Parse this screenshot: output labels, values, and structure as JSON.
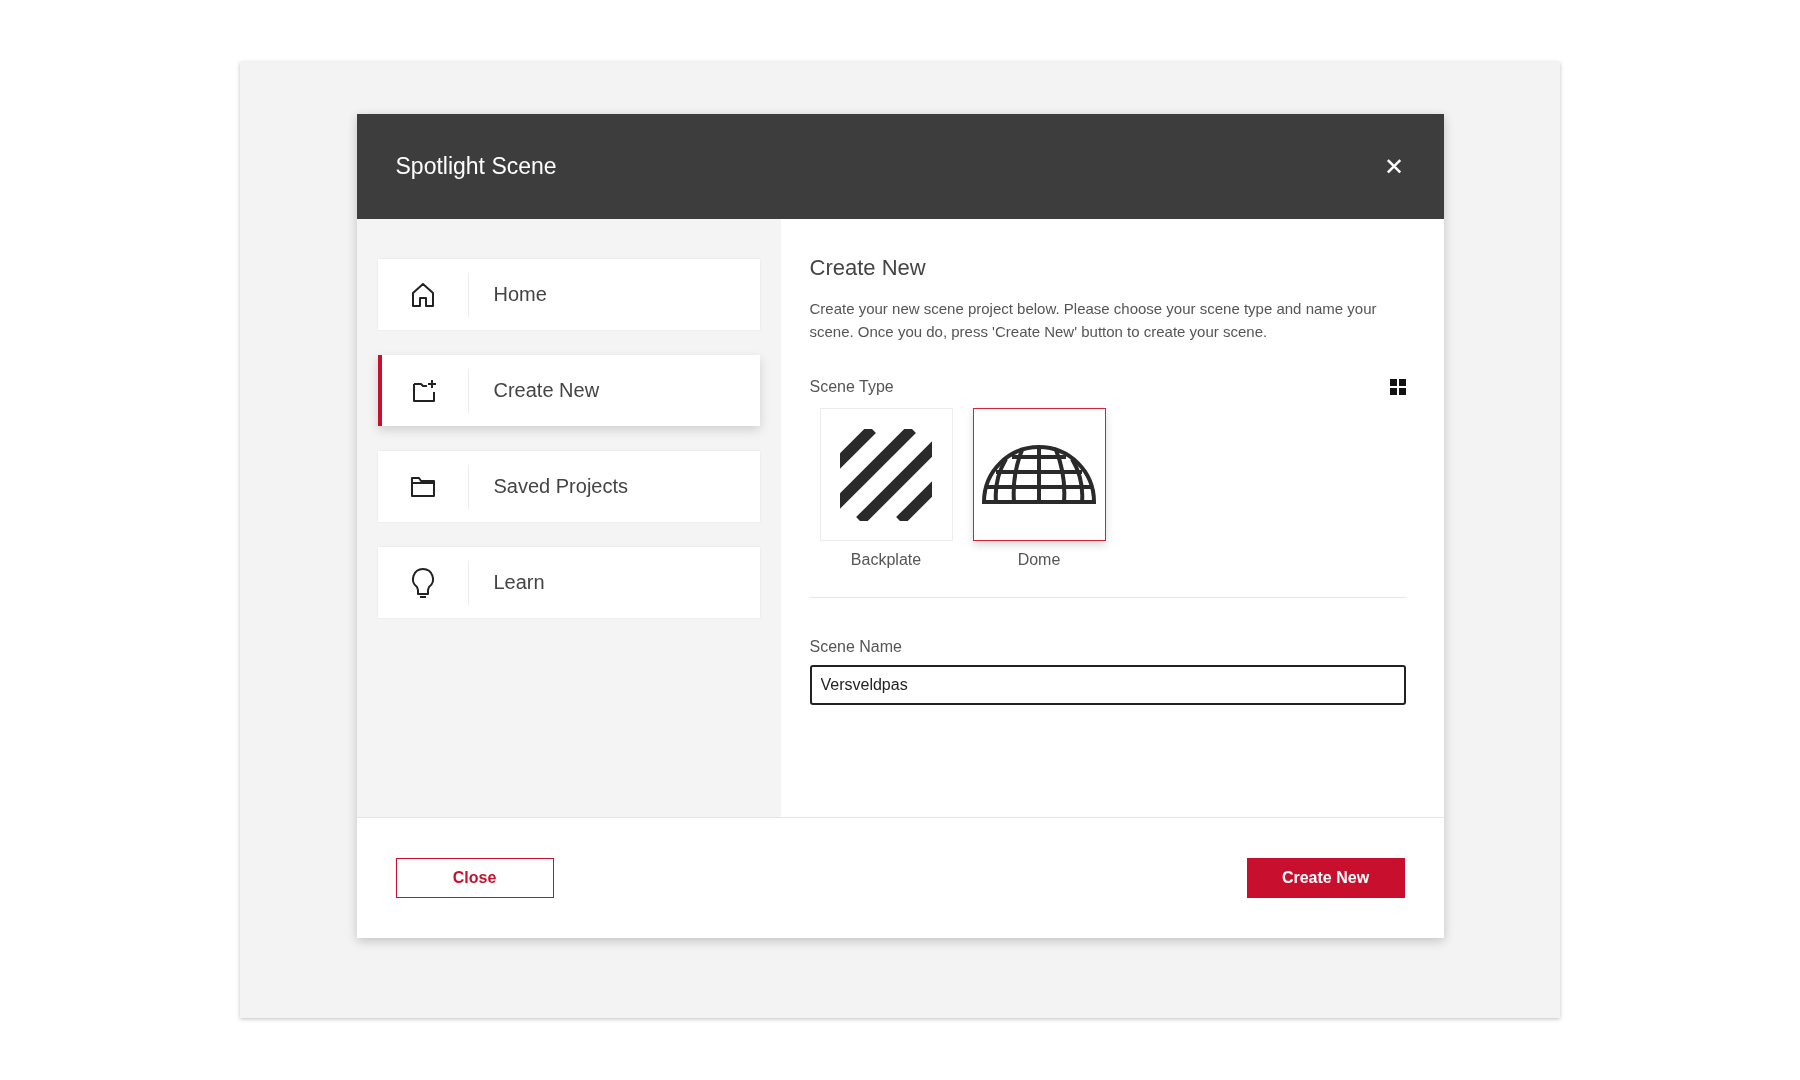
{
  "dialog": {
    "title": "Spotlight Scene",
    "close_icon": "✕"
  },
  "sidebar": {
    "items": [
      {
        "label": "Home",
        "selected": false
      },
      {
        "label": "Create New",
        "selected": true
      },
      {
        "label": "Saved Projects",
        "selected": false
      },
      {
        "label": "Learn",
        "selected": false
      }
    ]
  },
  "content": {
    "heading": "Create New",
    "description": "Create your new scene project below. Please choose your scene type and name your scene. Once you do, press 'Create New' button to create your scene.",
    "scene_type": {
      "label": "Scene Type",
      "options": [
        {
          "label": "Backplate",
          "kind": "backplate",
          "selected": false
        },
        {
          "label": "Dome",
          "kind": "dome",
          "selected": true
        }
      ]
    },
    "scene_name": {
      "label": "Scene Name",
      "value": "Versveldpas"
    }
  },
  "footer": {
    "buttons": [
      {
        "label": "Close",
        "kind": "secondary"
      },
      {
        "label": "Create New",
        "kind": "primary"
      }
    ]
  }
}
